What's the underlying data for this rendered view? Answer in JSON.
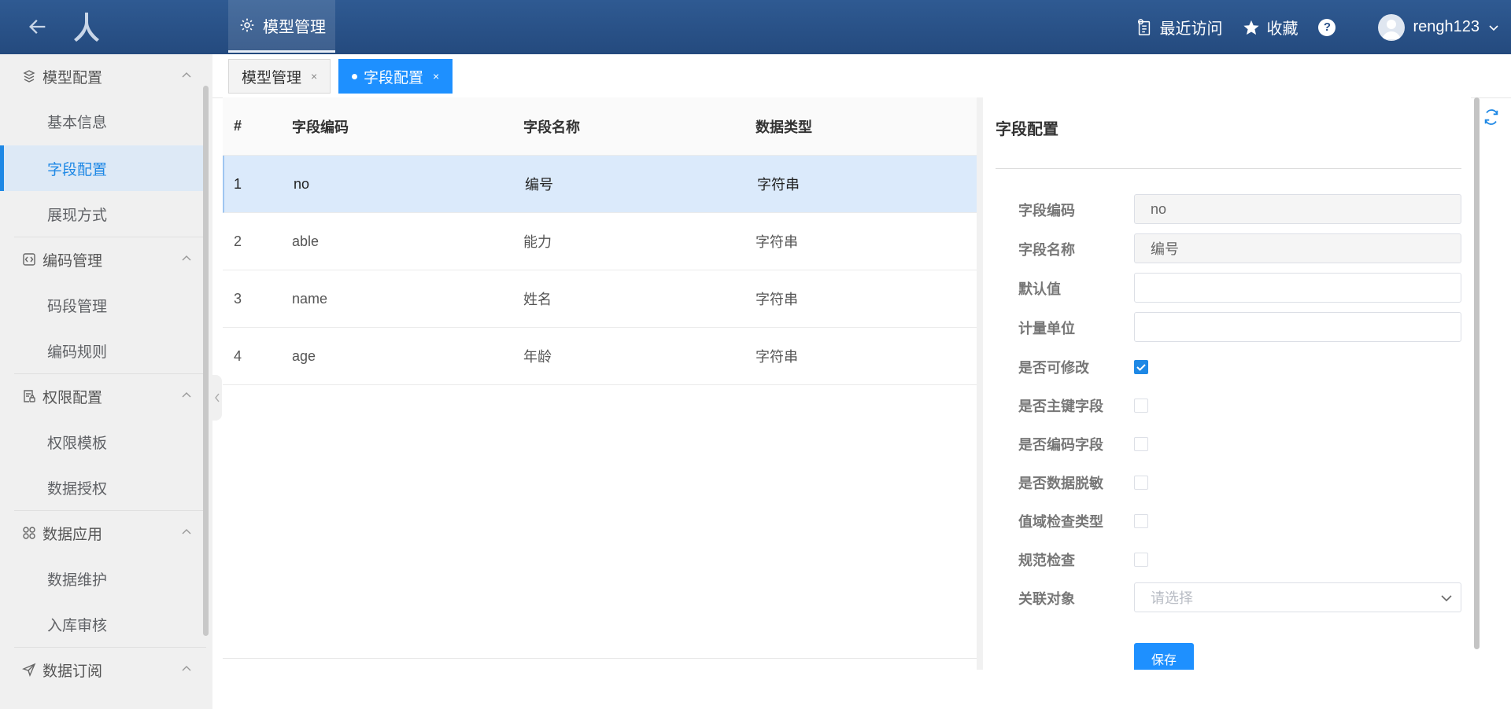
{
  "header": {
    "menu_tab": "模型管理",
    "recent": "最近访问",
    "favorite": "收藏",
    "help": "?",
    "username": "rengh123",
    "colors": {
      "bar": "#2a5189",
      "accent": "#1e90ff"
    }
  },
  "sidebar": {
    "groups": [
      {
        "label": "模型配置",
        "icon": "model-icon",
        "items": [
          "基本信息",
          "字段配置",
          "展现方式"
        ]
      },
      {
        "label": "编码管理",
        "icon": "code-icon",
        "items": [
          "码段管理",
          "编码规则"
        ]
      },
      {
        "label": "权限配置",
        "icon": "permission-icon",
        "items": [
          "权限模板",
          "数据授权"
        ]
      },
      {
        "label": "数据应用",
        "icon": "apps-icon",
        "items": [
          "数据维护",
          "入库审核"
        ]
      },
      {
        "label": "数据订阅",
        "icon": "send-icon",
        "items": []
      }
    ],
    "active_item": "字段配置"
  },
  "tabs": [
    {
      "label": "模型管理",
      "close": "×"
    },
    {
      "label": "字段配置",
      "close": "×"
    }
  ],
  "table": {
    "columns": [
      "#",
      "字段编码",
      "字段名称",
      "数据类型"
    ],
    "rows": [
      [
        "1",
        "no",
        "编号",
        "字符串"
      ],
      [
        "2",
        "able",
        "能力",
        "字符串"
      ],
      [
        "3",
        "name",
        "姓名",
        "字符串"
      ],
      [
        "4",
        "age",
        "年龄",
        "字符串"
      ]
    ]
  },
  "panel": {
    "title": "字段配置",
    "fields": {
      "code": {
        "label": "字段编码",
        "value": "no"
      },
      "name": {
        "label": "字段名称",
        "value": "编号"
      },
      "default": {
        "label": "默认值",
        "value": ""
      },
      "unit": {
        "label": "计量单位",
        "value": ""
      }
    },
    "checks": [
      {
        "label": "是否可修改",
        "checked": true
      },
      {
        "label": "是否主键字段",
        "checked": false
      },
      {
        "label": "是否编码字段",
        "checked": false
      },
      {
        "label": "是否数据脱敏",
        "checked": false
      },
      {
        "label": "值域检查类型",
        "checked": false
      },
      {
        "label": "规范检查",
        "checked": false
      }
    ],
    "relation": {
      "label": "关联对象",
      "placeholder": "请选择"
    },
    "save": "保存"
  }
}
